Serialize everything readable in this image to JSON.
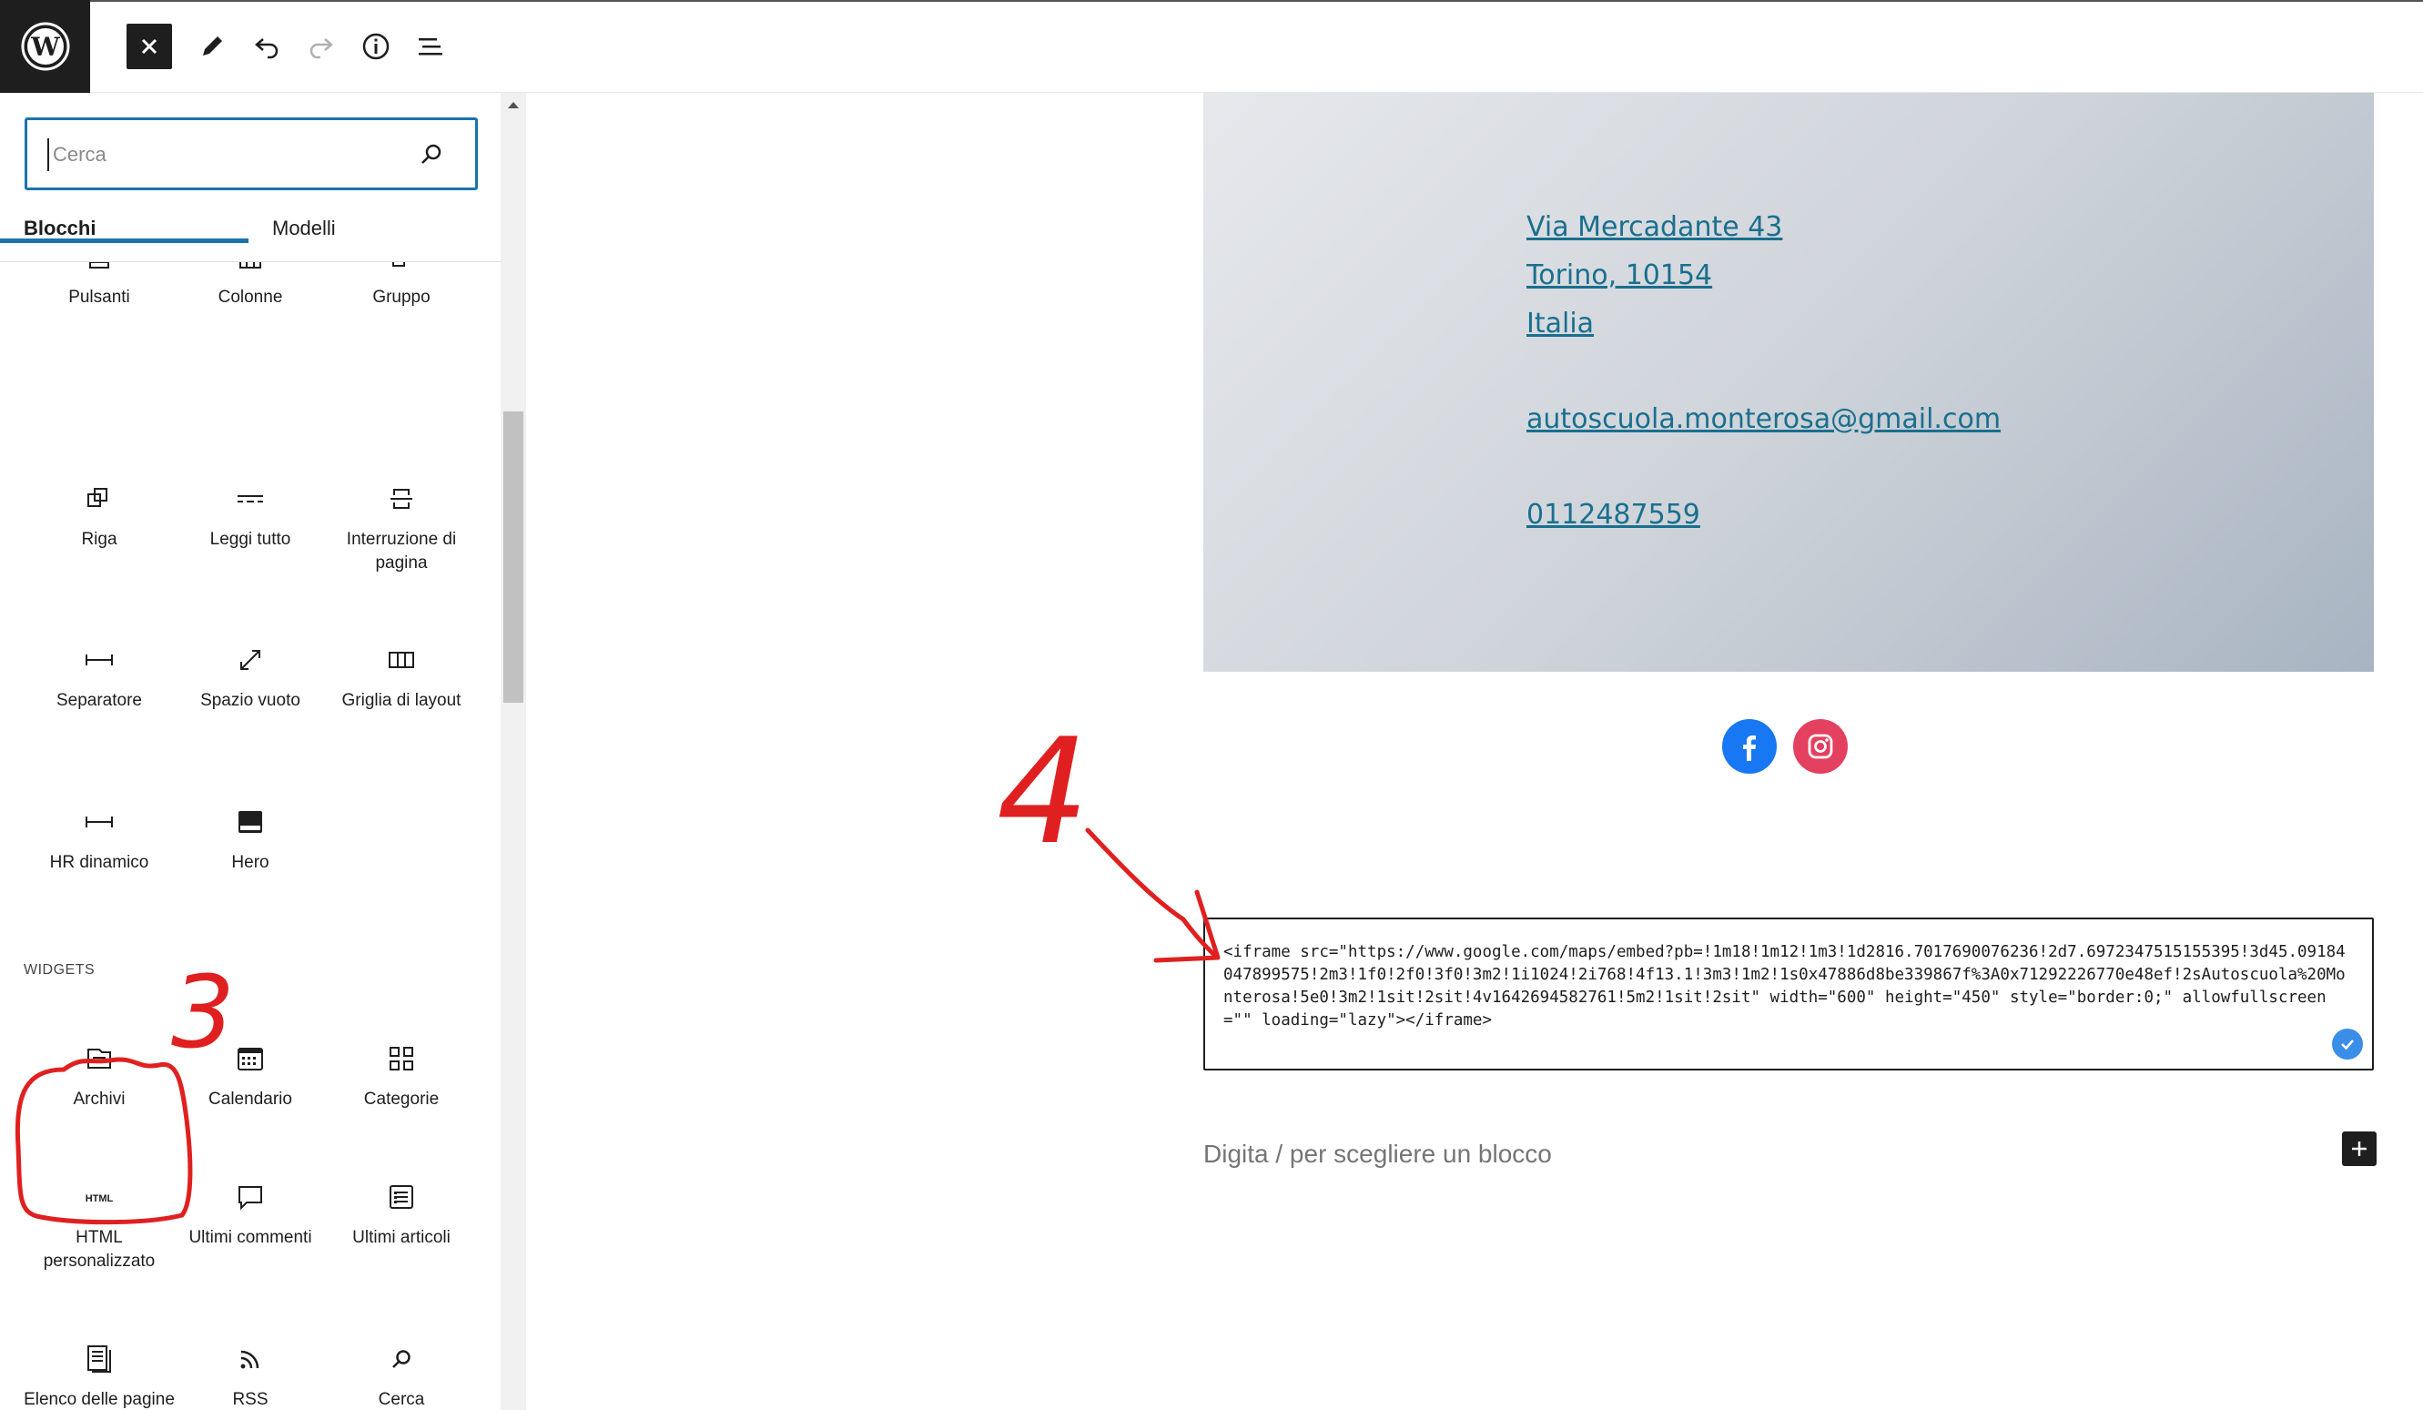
{
  "toolbar": {
    "logo": "wordpress-logo",
    "buttons": [
      "close",
      "edit",
      "undo",
      "redo",
      "details",
      "list-view"
    ]
  },
  "sidebar": {
    "search": {
      "placeholder": "Cerca",
      "value": ""
    },
    "tabs": [
      {
        "label": "Blocchi",
        "active": true
      },
      {
        "label": "Modelli",
        "active": false
      }
    ],
    "design_blocks": [
      {
        "label": "Pulsanti",
        "icon": "buttons-icon"
      },
      {
        "label": "Colonne",
        "icon": "columns-icon"
      },
      {
        "label": "Gruppo",
        "icon": "group-icon"
      },
      {
        "label": "Riga",
        "icon": "row-icon"
      },
      {
        "label": "Leggi tutto",
        "icon": "more-icon"
      },
      {
        "label": "Interruzione di pagina",
        "icon": "page-break-icon"
      },
      {
        "label": "Separatore",
        "icon": "separator-icon"
      },
      {
        "label": "Spazio vuoto",
        "icon": "spacer-icon"
      },
      {
        "label": "Griglia di layout",
        "icon": "layout-grid-icon"
      },
      {
        "label": "HR dinamico",
        "icon": "hr-icon"
      },
      {
        "label": "Hero",
        "icon": "hero-icon"
      }
    ],
    "widgets_heading": "WIDGETS",
    "widget_blocks": [
      {
        "label": "Archivi",
        "icon": "archive-icon"
      },
      {
        "label": "Calendario",
        "icon": "calendar-icon"
      },
      {
        "label": "Categorie",
        "icon": "categories-icon"
      },
      {
        "label": "HTML personalizzato",
        "icon": "html-icon",
        "icon_text": "HTML"
      },
      {
        "label": "Ultimi commenti",
        "icon": "comment-icon"
      },
      {
        "label": "Ultimi articoli",
        "icon": "latest-posts-icon"
      },
      {
        "label": "Elenco delle pagine",
        "icon": "page-list-icon"
      },
      {
        "label": "RSS",
        "icon": "rss-icon"
      },
      {
        "label": "Cerca",
        "icon": "search-icon"
      }
    ]
  },
  "canvas": {
    "contact": {
      "address_line1": "Via Mercadante 43",
      "address_line2": "Torino, 10154",
      "country": "Italia",
      "email": "autoscuola.monterosa@gmail.com",
      "phone": "0112487559"
    },
    "social": [
      "facebook-icon",
      "instagram-icon"
    ],
    "html_block_code": "<iframe src=\"https://www.google.com/maps/embed?pb=!1m18!1m12!1m3!1d2816.7017690076236!2d7.6972347515155395!3d45.09184047899575!2m3!1f0!2f0!3f0!3m2!1i1024!2i768!4f13.1!3m3!1m2!1s0x47886d8be339867f%3A0x71292226770e48ef!2sAutoscuola%20Monterosa!5e0!3m2!1sit!2sit!4v1642694582761!5m2!1sit!2sit\" width=\"600\" height=\"450\" style=\"border:0;\" allowfullscreen=\"\" loading=\"lazy\"></iframe>",
    "placeholder": "Digita / per scegliere un blocco"
  },
  "annotations": {
    "step3": "3",
    "step4": "4",
    "color": "#e02020"
  },
  "colors": {
    "accent": "#1a73ad",
    "link": "#1a6f8e",
    "dark": "#1e1e1e"
  }
}
